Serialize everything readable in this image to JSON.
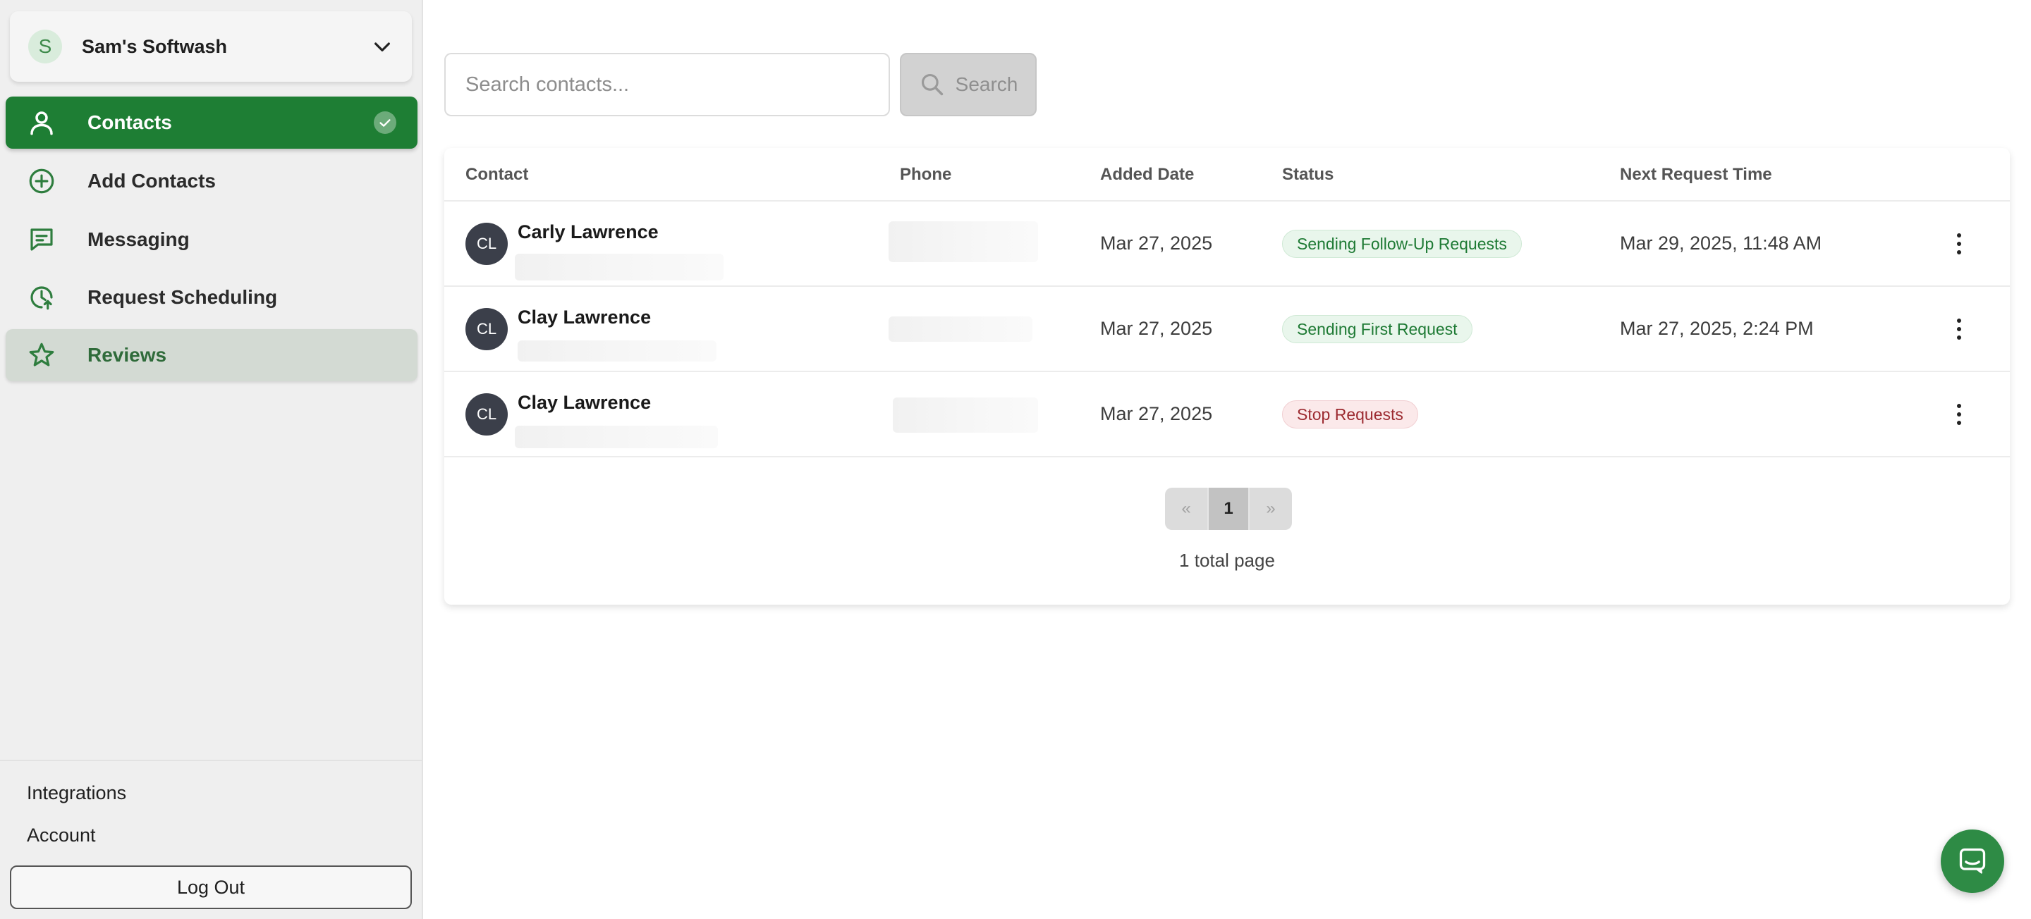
{
  "organization": {
    "initial": "S",
    "name": "Sam's Softwash"
  },
  "sidebar": {
    "items": [
      {
        "label": "Contacts",
        "icon": "person-icon",
        "state": "active"
      },
      {
        "label": "Add Contacts",
        "icon": "plus-circle-icon",
        "state": "default"
      },
      {
        "label": "Messaging",
        "icon": "chat-bubble-icon",
        "state": "default"
      },
      {
        "label": "Request Scheduling",
        "icon": "clock-arrow-icon",
        "state": "default"
      },
      {
        "label": "Reviews",
        "icon": "star-icon",
        "state": "selected"
      }
    ],
    "footer": {
      "integrations": "Integrations",
      "account": "Account",
      "logout": "Log Out"
    }
  },
  "search": {
    "placeholder": "Search contacts...",
    "button_label": "Search"
  },
  "table": {
    "columns": [
      "Contact",
      "Phone",
      "Added Date",
      "Status",
      "Next Request Time"
    ],
    "rows": [
      {
        "initials": "CL",
        "name": "Carly Lawrence",
        "added": "Mar 27, 2025",
        "status": "Sending Follow-Up Requests",
        "status_tone": "green",
        "next": "Mar 29, 2025, 11:48 AM"
      },
      {
        "initials": "CL",
        "name": "Clay Lawrence",
        "added": "Mar 27, 2025",
        "status": "Sending First Request",
        "status_tone": "green",
        "next": "Mar 27, 2025, 2:24 PM"
      },
      {
        "initials": "CL",
        "name": "Clay Lawrence",
        "added": "Mar 27, 2025",
        "status": "Stop Requests",
        "status_tone": "red",
        "next": ""
      }
    ]
  },
  "pagination": {
    "prev": "«",
    "current": "1",
    "next": "»",
    "total": "1 total page"
  },
  "colors": {
    "brand_green": "#1e7e34",
    "status_green": "#1e7a34",
    "status_red": "#9c2a30",
    "sidebar_bg": "#efefef"
  }
}
